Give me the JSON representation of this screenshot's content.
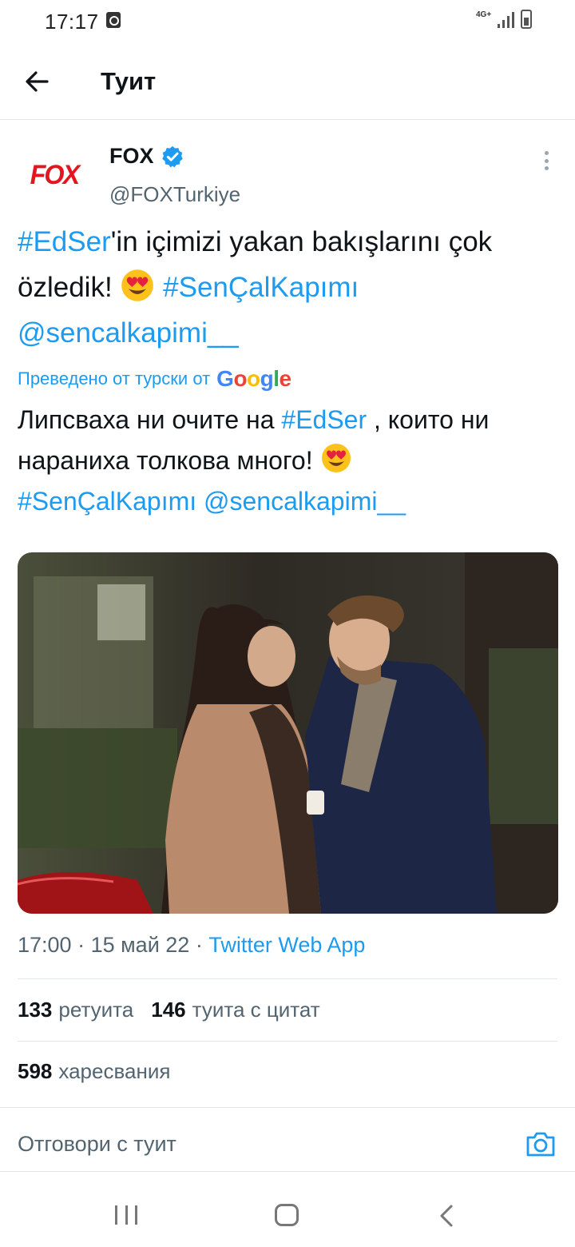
{
  "status_bar": {
    "time": "17:17",
    "network": "4G+",
    "notification_icon": "screen-record-icon",
    "signal_icon": "signal-icon",
    "battery_icon": "battery-icon"
  },
  "header": {
    "title": "Туит",
    "back_icon": "arrow-left-icon"
  },
  "tweet": {
    "author_name": "FOX",
    "author_handle": "@FOXTurkiye",
    "avatar_text": "FOX",
    "verified_icon": "verified-badge-icon",
    "more_icon": "more-vertical-icon",
    "text": {
      "hashtag1": "#EdSer",
      "part1": "'in içimizi yakan bakışlarını çok özledik! ",
      "emoji": "heart-eyes-emoji",
      "hashtag2": "#SenÇalKapımı",
      "mention": "@sencalkapimi__"
    },
    "translated_label": "Преведено от турски от",
    "translation_provider": "Google",
    "translation": {
      "part1": "Липсваха ни очите на ",
      "hashtag1": "#EdSer",
      "part2": " , които ни нараниха толкова много! ",
      "hashtag2": "#SenÇalKapımı",
      "mention": "@sencalkapimi__"
    },
    "meta": {
      "time": "17:00",
      "separator": " · ",
      "date": "15 май 22",
      "source": "Twitter Web App"
    },
    "stats": {
      "retweets_count": "133",
      "retweets_label": "ретуита",
      "quotes_count": "146",
      "quotes_label": "туита с цитат",
      "likes_count": "598",
      "likes_label": "харесвания"
    }
  },
  "reply": {
    "placeholder": "Отговори с туит",
    "camera_icon": "camera-icon"
  },
  "navbar": {
    "recents_icon": "recents-icon",
    "home_icon": "home-icon",
    "back_icon": "chevron-left-icon"
  },
  "colors": {
    "accent": "#1d9bf0",
    "text_primary": "#0f1419",
    "text_secondary": "#536471",
    "brand_fox": "#e4151f"
  }
}
